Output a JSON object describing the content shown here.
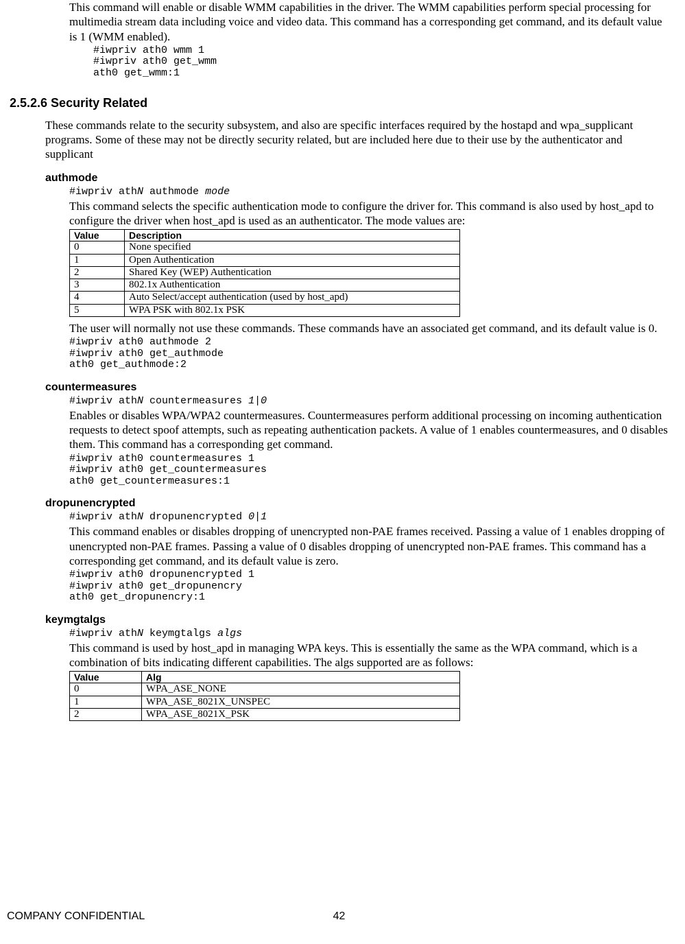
{
  "wmm": {
    "desc": "This command will enable or disable WMM capabilities in the driver. The WMM capabilities perform special processing for multimedia stream data including voice and video data. This command has a corresponding get command, and its default value is 1 (WMM enabled).",
    "example": "#iwpriv ath0 wmm 1\n#iwpriv ath0 get_wmm\nath0 get_wmm:1"
  },
  "section": {
    "number_title": "2.5.2.6 Security Related",
    "intro": "These commands relate to the security subsystem, and also are specific interfaces required by the hostapd and wpa_supplicant programs. Some of these may not be directly security related, but are included here due to their use by the authenticator and supplicant"
  },
  "authmode": {
    "name": "authmode",
    "syntax_pre": "#iwpriv ath",
    "syntax_n": "N",
    "syntax_mid": " authmode ",
    "syntax_arg": "mode",
    "desc": "This command selects the specific authentication mode to configure the driver for. This command is also used by host_apd to configure the driver when host_apd is used as an authenticator. The mode values are:",
    "table_headers": {
      "c1": "Value",
      "c2": "Description"
    },
    "rows": [
      {
        "v": "0",
        "d": "None specified"
      },
      {
        "v": "1",
        "d": "Open Authentication"
      },
      {
        "v": "2",
        "d": "Shared Key (WEP) Authentication"
      },
      {
        "v": "3",
        "d": "802.1x Authentication"
      },
      {
        "v": "4",
        "d": "Auto Select/accept authentication (used by host_apd)"
      },
      {
        "v": "5",
        "d": "WPA PSK with 802.1x PSK"
      }
    ],
    "after": "The user will normally not use these commands. These commands have an associated get command, and its default value is 0.",
    "example": "#iwpriv ath0 authmode 2\n#iwpriv ath0 get_authmode\nath0 get_authmode:2"
  },
  "countermeasures": {
    "name": "countermeasures",
    "syntax_pre": "#iwpriv ath",
    "syntax_n": "N",
    "syntax_mid": " countermeasures ",
    "syntax_arg": "1|0",
    "desc": "Enables or disables WPA/WPA2 countermeasures. Countermeasures perform additional processing on incoming authentication requests to detect spoof attempts, such as repeating authentication packets. A value of 1 enables countermeasures, and 0 disables them. This command has a corresponding get command.",
    "example": "#iwpriv ath0 countermeasures 1\n#iwpriv ath0 get_countermeasures\nath0 get_countermeasures:1"
  },
  "dropunencrypted": {
    "name": "dropunencrypted",
    "syntax_pre": "#iwpriv ath",
    "syntax_n": "N",
    "syntax_mid": " dropunencrypted ",
    "syntax_arg": "0|1",
    "desc": "This command enables or disables dropping of unencrypted non-PAE frames received. Passing a value of 1 enables dropping of unencrypted non-PAE frames. Passing a value of 0 disables dropping of unencrypted non-PAE frames. This command has a corresponding get command, and its default value is zero.",
    "example": "#iwpriv ath0 dropunencrypted 1\n#iwpriv ath0 get_dropunencry\nath0 get_dropunencry:1"
  },
  "keymgtalgs": {
    "name": "keymgtalgs",
    "syntax_pre": "#iwpriv ath",
    "syntax_n": "N",
    "syntax_mid": " keymgtalgs ",
    "syntax_arg": "algs",
    "desc": "This command is used by host_apd in managing WPA keys. This is essentially the same as the WPA command, which is a combination of bits indicating different capabilities. The algs supported are as follows:",
    "table_headers": {
      "c1": "Value",
      "c2": "Alg"
    },
    "rows": [
      {
        "v": "0",
        "d": "WPA_ASE_NONE"
      },
      {
        "v": "1",
        "d": "WPA_ASE_8021X_UNSPEC"
      },
      {
        "v": "2",
        "d": "WPA_ASE_8021X_PSK"
      }
    ]
  },
  "footer": {
    "left": "COMPANY CONFIDENTIAL",
    "page": "42"
  }
}
